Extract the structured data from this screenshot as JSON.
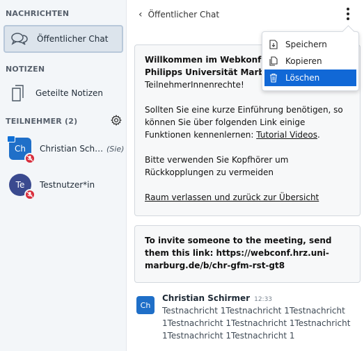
{
  "sidebar": {
    "messages_title": "NACHRICHTEN",
    "public_chat_label": "Öffentlicher Chat",
    "notes_title": "NOTIZEN",
    "shared_notes_label": "Geteilte Notizen",
    "participants_title": "TEILNEHMER (2)",
    "participants": [
      {
        "initials": "Ch",
        "name": "Christian Schirmer",
        "suffix": "(Sie)",
        "color": "#1f6fc8",
        "shape": "rounded",
        "presenter": true,
        "muted": true
      },
      {
        "initials": "Te",
        "name": "Testnutzer*in",
        "suffix": "",
        "color": "#3a4a8f",
        "shape": "circle",
        "presenter": false,
        "muted": true
      }
    ]
  },
  "chat": {
    "back_icon": "chevron-left-icon",
    "title": "Öffentlicher Chat",
    "welcome": {
      "line1": "Willkommen im Webkonferenz",
      "line2": "Philipps Universität Marburg",
      "line3": "TeilnehmerInnenrechte!",
      "para2_text": "Sollten Sie eine kurze Einführung benötigen, so können Sie über folgenden Link einige Funktionen kennenlernen: ",
      "tutorial_link": "Tutorial Videos",
      "para2_end": ".",
      "para3": "Bitte verwenden Sie Kopfhörer um Rückkopplungen zu vermeiden",
      "leave_link": "Raum verlassen und zurück zur Übersicht"
    },
    "invite_text": "To invite someone to the meeting, send them this link: https://webconf.hrz.uni-marburg.de/b/chr-gfm-rst-gt8",
    "message": {
      "initials": "Ch",
      "sender": "Christian Schirmer",
      "time": "12:33",
      "text": "Testnachricht 1Testnachricht 1Testnachricht 1Testnachricht 1Testnachricht 1Testnachricht 1Testnachricht 1Testnachricht 1"
    }
  },
  "menu": {
    "items": [
      {
        "label": "Speichern",
        "icon": "download-icon"
      },
      {
        "label": "Kopieren",
        "icon": "copy-icon"
      },
      {
        "label": "Löschen",
        "icon": "trash-icon"
      }
    ],
    "active_index": 2,
    "accent": "#1168d6"
  },
  "colors": {
    "sidebar_bg": "#f3f6f9",
    "mute_badge": "#d82c3b",
    "card_bg": "#f7f8f9"
  }
}
